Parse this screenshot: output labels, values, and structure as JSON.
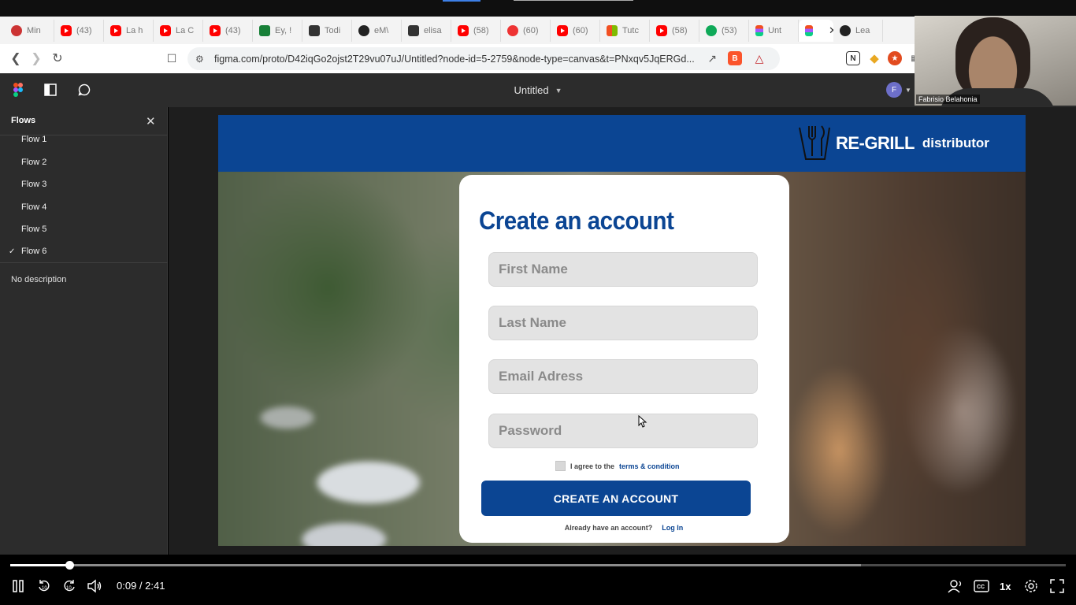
{
  "browser": {
    "tabs": [
      {
        "label": "Min",
        "icon": "recording-icon"
      },
      {
        "label": "(43)",
        "icon": "youtube-icon"
      },
      {
        "label": "La h",
        "icon": "youtube-icon"
      },
      {
        "label": "La C",
        "icon": "youtube-icon"
      },
      {
        "label": "(43)",
        "icon": "youtube-icon"
      },
      {
        "label": "Ey, !",
        "icon": "chat-icon"
      },
      {
        "label": "Todi",
        "icon": "profile-icon"
      },
      {
        "label": "eM\\",
        "icon": "github-icon"
      },
      {
        "label": "elisa",
        "icon": "app-icon"
      },
      {
        "label": "(58)",
        "icon": "youtube-icon"
      },
      {
        "label": "(60)",
        "icon": "record-icon"
      },
      {
        "label": "(60)",
        "icon": "youtube-icon"
      },
      {
        "label": "Tutc",
        "icon": "microsoft-icon"
      },
      {
        "label": "(58)",
        "icon": "youtube-icon"
      },
      {
        "label": "(53)",
        "icon": "green-app-icon"
      },
      {
        "label": "Unt",
        "icon": "figma-icon"
      },
      {
        "label": "",
        "icon": "figma-icon",
        "active": true
      },
      {
        "label": "Lea",
        "icon": "github-icon"
      }
    ],
    "url": "figma.com/proto/D42iqGo2ojst2T29vu07uJ/Untitled?node-id=5-2759&node-type=canvas&t=PNxqv5JqERGd..."
  },
  "webcam": {
    "name": "Fabrisio Belahonia"
  },
  "figma": {
    "file_title": "Untitled",
    "avatar_initial": "F",
    "sidebar": {
      "title": "Flows",
      "flows": [
        "Flow 1",
        "Flow 2",
        "Flow 3",
        "Flow 4",
        "Flow 5",
        "Flow 6"
      ],
      "selected_flow": "Flow 6",
      "description": "No description"
    }
  },
  "prototype": {
    "brand": "RE-GRILL",
    "brand_sub": "distributor",
    "title": "Create an account",
    "fields": [
      {
        "placeholder": "First Name"
      },
      {
        "placeholder": "Last Name"
      },
      {
        "placeholder": "Email Adress"
      },
      {
        "placeholder": "Password"
      }
    ],
    "agree_text": "I agree to the",
    "terms_link": "terms & condition",
    "cta_label": "CREATE AN ACCOUNT",
    "already_text": "Already have an account?",
    "login_link": "Log In",
    "colors": {
      "brand_blue": "#0b4593",
      "field_bg": "#e3e3e3"
    }
  },
  "video": {
    "current_time": "0:09",
    "duration": "2:41",
    "time_display": "0:09 / 2:41",
    "progress_fraction": 0.0559,
    "buffered_fraction": 0.806,
    "speed": "1x"
  }
}
